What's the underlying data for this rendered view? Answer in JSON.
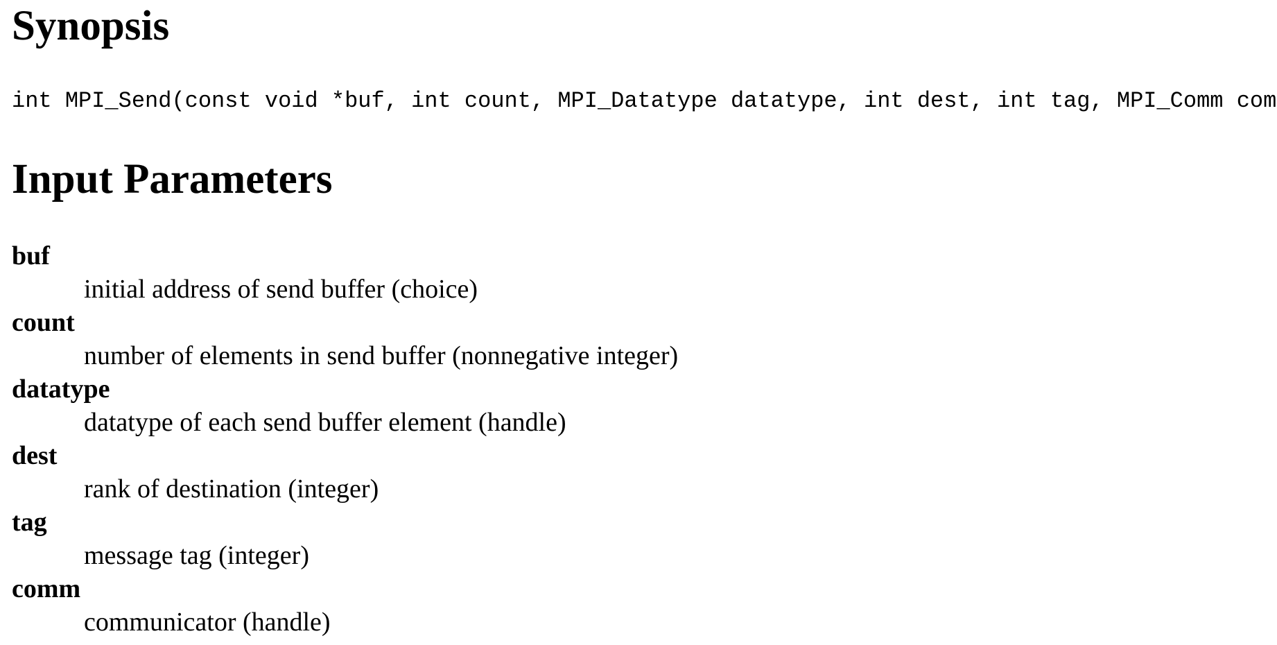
{
  "synopsis": {
    "heading": "Synopsis",
    "signature": "int MPI_Send(const void *buf, int count, MPI_Datatype datatype, int dest, int tag, MPI_Comm comm)"
  },
  "input_parameters": {
    "heading": "Input Parameters",
    "params": [
      {
        "name": "buf",
        "description": "initial address of send buffer (choice)"
      },
      {
        "name": "count",
        "description": "number of elements in send buffer (nonnegative integer)"
      },
      {
        "name": "datatype",
        "description": "datatype of each send buffer element (handle)"
      },
      {
        "name": "dest",
        "description": "rank of destination (integer)"
      },
      {
        "name": "tag",
        "description": "message tag (integer)"
      },
      {
        "name": "comm",
        "description": "communicator (handle)"
      }
    ]
  }
}
